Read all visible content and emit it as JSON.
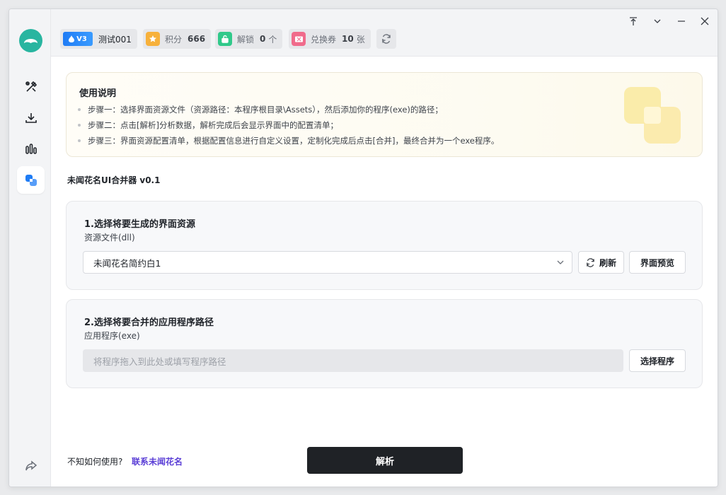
{
  "window_controls": {
    "pin": "pin-icon",
    "minimize_down": "chevron-down-icon",
    "minimize": "minimize-icon",
    "close": "close-icon"
  },
  "user": {
    "badge": "V3",
    "name": "测试001"
  },
  "stats": [
    {
      "label": "积分",
      "value": "666",
      "unit": "",
      "icon": "star-icon",
      "color": "#f7b13b"
    },
    {
      "label": "解锁",
      "value": "0",
      "unit": "个",
      "icon": "unlock-icon",
      "color": "#30c98a"
    },
    {
      "label": "兑换券",
      "value": "10",
      "unit": "张",
      "icon": "ticket-icon",
      "color": "#f06b8b"
    }
  ],
  "sidebar": {
    "items": [
      "tools-icon",
      "download-icon",
      "stats-icon",
      "merge-icon"
    ],
    "active": "merge-icon",
    "bottom": "share-icon"
  },
  "instructions": {
    "title": "使用说明",
    "steps": [
      "步骤一：选择界面资源文件（资源路径：本程序根目录\\Assets），然后添加你的程序(exe)的路径；",
      "步骤二：点击[解析]分析数据，解析完成后会显示界面中的配置清单；",
      "步骤三：界面资源配置清单，根据配置信息进行自定义设置，定制化完成后点击[合并]，最终合并为一个exe程序。"
    ]
  },
  "app_title": "未闻花名UI合并器 v0.1",
  "section1": {
    "title": "1.选择将要生成的界面资源",
    "subtitle": "资源文件(dll)",
    "selected": "未闻花名简约白1",
    "refresh_label": "刷新",
    "preview_label": "界面预览"
  },
  "section2": {
    "title": "2.选择将要合并的应用程序路径",
    "subtitle": "应用程序(exe)",
    "placeholder": "将程序拖入到此处或填写程序路径",
    "choose_label": "选择程序"
  },
  "footer": {
    "help_text": "不知如何使用?",
    "help_link": "联系未闻花名",
    "parse_label": "解析"
  }
}
